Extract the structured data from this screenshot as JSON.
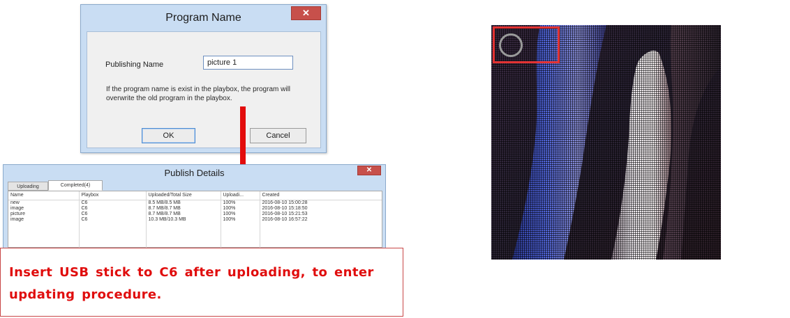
{
  "program_name_dialog": {
    "title": "Program Name",
    "close_glyph": "✕",
    "publishing_name_label": "Publishing Name",
    "publishing_name_value": "picture 1",
    "note": "If the program name is exist in the playbox, the program will overwrite the old program in the  playbox.",
    "ok_label": "OK",
    "cancel_label": "Cancel"
  },
  "publish_details": {
    "title": "Publish Details",
    "close_glyph": "✕",
    "tabs": [
      "Uploading",
      "Completed(4)"
    ],
    "columns": [
      "Name",
      "Playbox",
      "Uploaded/Total Size",
      "Uploadi...",
      "Created"
    ],
    "rows": [
      [
        "new",
        "C6",
        "8.5 MB/8.5 MB",
        "100%",
        "2016-08-10 15:00:28"
      ],
      [
        "image",
        "C6",
        "8.7 MB/8.7 MB",
        "100%",
        "2016-08-10 15:18:50"
      ],
      [
        "picture",
        "C6",
        "8.7 MB/8.7 MB",
        "100%",
        "2016-08-10 15:21:53"
      ],
      [
        "image",
        "C6",
        "10.3 MB/10.3 MB",
        "100%",
        "2016-08-10 16:57:22"
      ]
    ]
  },
  "instruction": "Insert USB stick to C6 after uploading, to enter updating procedure.",
  "colors": {
    "arrow": "#e30c0c",
    "instruction_text": "#e00d0d",
    "dialog_frame": "#c9ddf3",
    "close_button": "#c7504b"
  },
  "icons": [
    "close-icon",
    "arrow-down-icon",
    "focus-circle-icon"
  ]
}
